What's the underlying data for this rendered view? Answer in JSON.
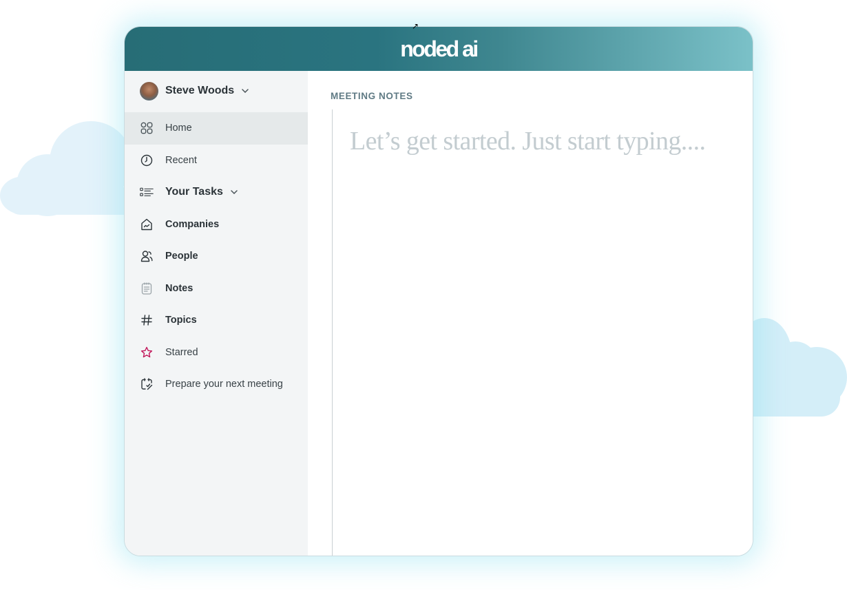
{
  "app": {
    "logo_text": "noded ai",
    "brand_colors": {
      "header_start": "#276d76",
      "header_end": "#7bc1c8",
      "sidebar_bg": "#f3f5f6",
      "starred_icon": "#c2185b"
    }
  },
  "user": {
    "name": "Steve Woods",
    "menu_icon": "chevron-down-icon"
  },
  "sidebar": {
    "items": [
      {
        "label": "Home",
        "icon": "grid-icon",
        "active": true
      },
      {
        "label": "Recent",
        "icon": "clock-icon"
      },
      {
        "label": "Your Tasks",
        "icon": "task-list-icon",
        "expandable": true
      },
      {
        "label": "Companies",
        "icon": "building-icon"
      },
      {
        "label": "People",
        "icon": "people-icon"
      },
      {
        "label": "Notes",
        "icon": "notes-icon"
      },
      {
        "label": "Topics",
        "icon": "hash-icon"
      },
      {
        "label": "Starred",
        "icon": "star-icon"
      },
      {
        "label": "Prepare your next meeting",
        "icon": "calendar-check-icon"
      }
    ]
  },
  "main": {
    "section_title": "MEETING NOTES",
    "editor_placeholder": "Let’s get started.  Just start typing...."
  }
}
